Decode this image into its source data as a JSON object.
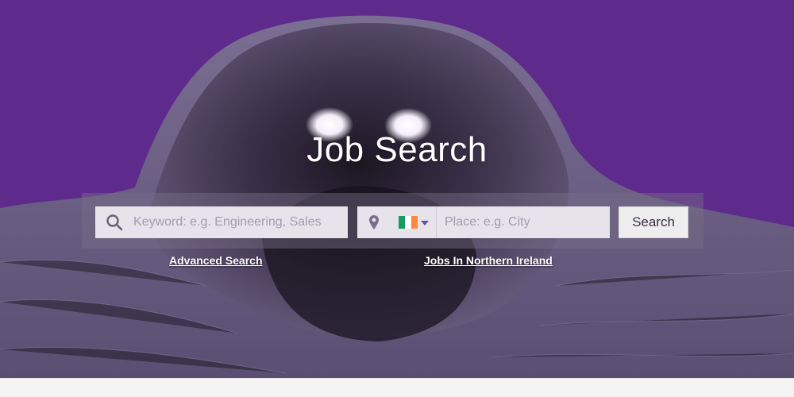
{
  "hero": {
    "title": "Job Search",
    "colors": {
      "background": "#5e2a8c",
      "fur": "#4a4060"
    }
  },
  "search": {
    "keyword_placeholder": "Keyword: e.g. Engineering, Sales",
    "keyword_icon": "search-icon",
    "location_icon": "map-pin-icon",
    "country_flag": "ireland-flag",
    "country_flag_colors": [
      "#169b62",
      "#ffffff",
      "#ff883e"
    ],
    "place_placeholder": "Place: e.g. City",
    "button_label": "Search"
  },
  "links": {
    "advanced_search": "Advanced Search",
    "northern_ireland": "Jobs In Northern Ireland"
  }
}
